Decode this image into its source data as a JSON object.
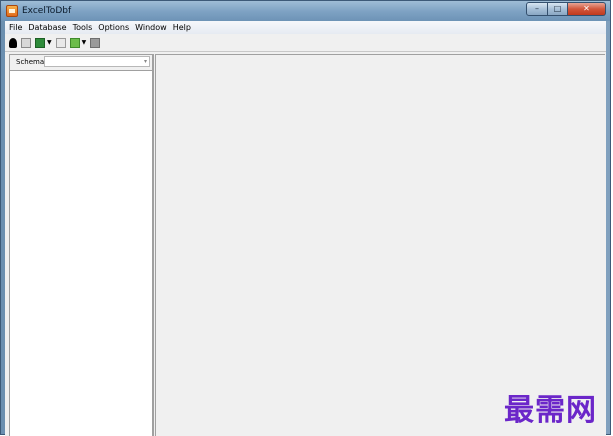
{
  "window": {
    "title": "ExcelToDbf",
    "controls": {
      "minimize": "–",
      "maximize": "□",
      "close": "✕"
    }
  },
  "menubar": {
    "items": [
      "File",
      "Database",
      "Tools",
      "Options",
      "Window",
      "Help"
    ]
  },
  "toolbar": {
    "icons": [
      "connect-icon",
      "document-icon",
      "excel-icon",
      "dropdown-arrow",
      "document-icon",
      "green-table-icon",
      "dropdown-arrow",
      "stop-icon"
    ],
    "dropdown_glyph": "▼"
  },
  "left_panel": {
    "schema_label": "Schema",
    "schema_value": "",
    "dropdown_glyph": "▾"
  },
  "watermark": {
    "text": "最需网"
  },
  "colors": {
    "titlebar": "#7fa3c4",
    "client_bg": "#f0f0f0",
    "close_button": "#c03a1f",
    "watermark": "#6b26c9"
  }
}
